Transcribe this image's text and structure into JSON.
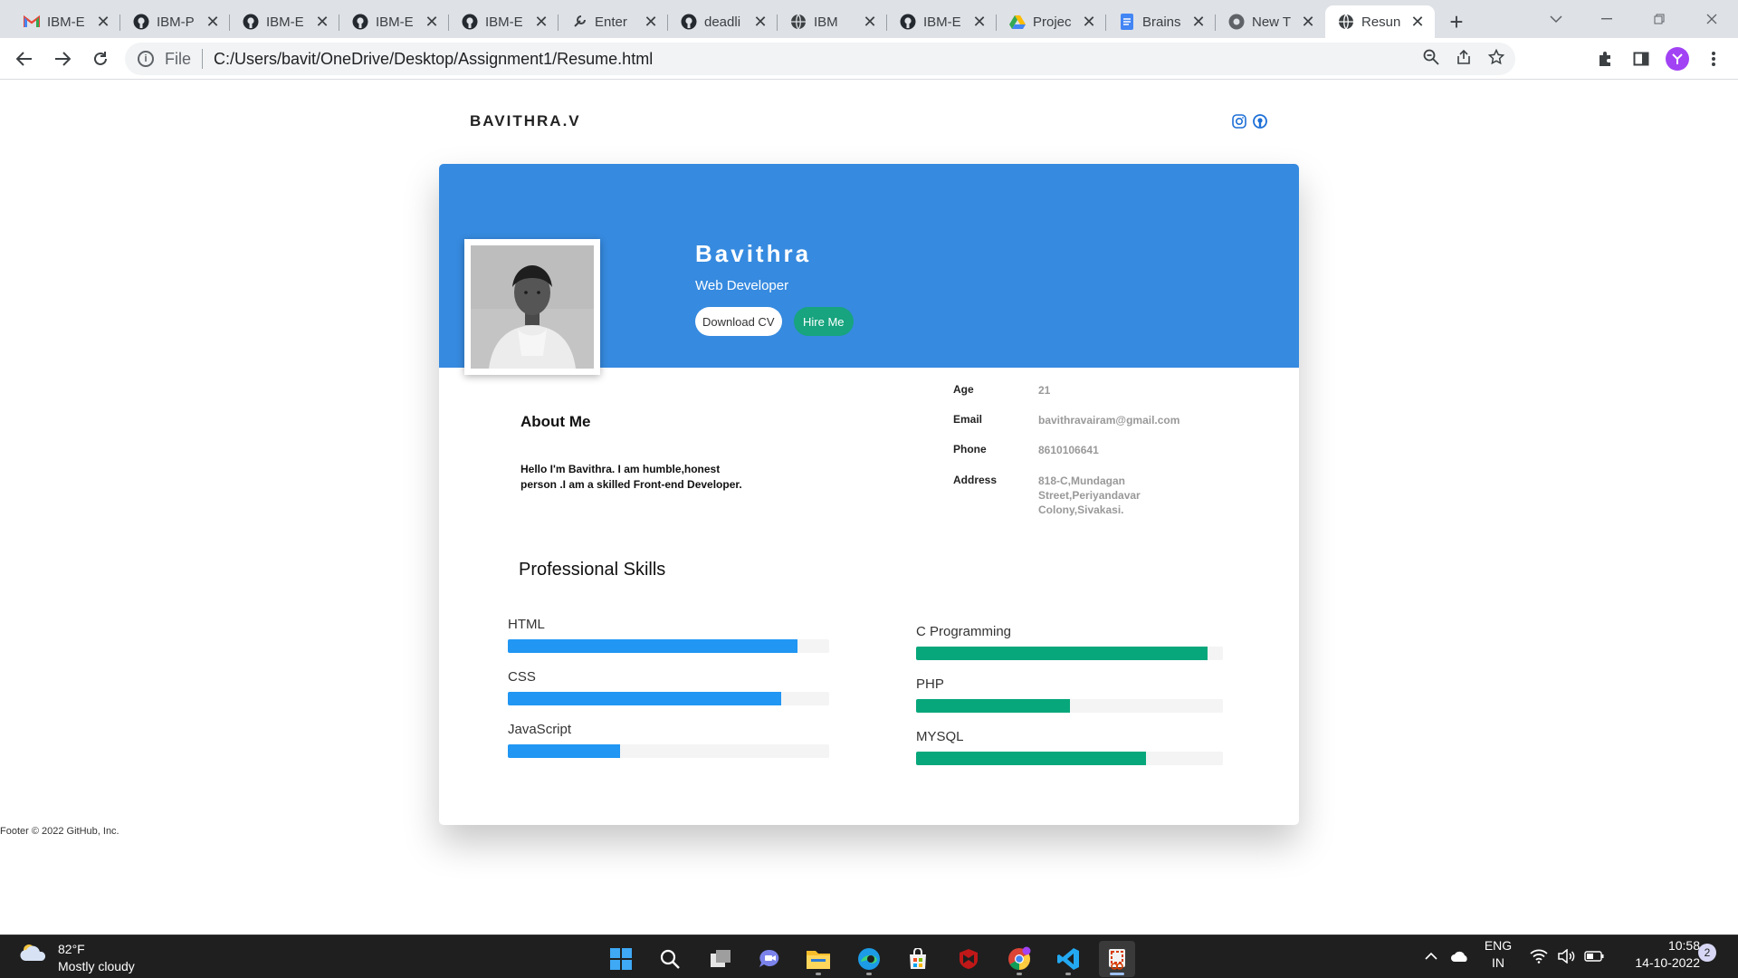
{
  "browser": {
    "tabs": [
      {
        "label": "IBM-E",
        "icon": "gmail-icon"
      },
      {
        "label": "IBM-P",
        "icon": "github-icon"
      },
      {
        "label": "IBM-E",
        "icon": "github-icon"
      },
      {
        "label": "IBM-E",
        "icon": "github-icon"
      },
      {
        "label": "IBM-E",
        "icon": "github-icon"
      },
      {
        "label": "Enter",
        "icon": "wrench-icon"
      },
      {
        "label": "deadli",
        "icon": "github-icon"
      },
      {
        "label": "IBM",
        "icon": "globe-icon"
      },
      {
        "label": "IBM-E",
        "icon": "github-icon"
      },
      {
        "label": "Projec",
        "icon": "google-drive-icon"
      },
      {
        "label": "Brains",
        "icon": "google-docs-icon"
      },
      {
        "label": "New T",
        "icon": "chrome-icon"
      },
      {
        "label": "Resun",
        "icon": "globe-icon"
      }
    ],
    "active_tab_index": 12,
    "address": {
      "scheme": "File",
      "url": "C:/Users/bavit/OneDrive/Desktop/Assignment1/Resume.html"
    }
  },
  "page": {
    "brand": "BAVITHRA.V",
    "profile": {
      "name": "Bavithra",
      "role": "Web Developer",
      "download_label": "Download CV",
      "hire_label": "Hire Me"
    },
    "about": {
      "title": "About Me",
      "text": "Hello I'm Bavithra. I am humble,honest person .I am a skilled Front-end Developer."
    },
    "info": [
      {
        "key": "Age",
        "value": "21"
      },
      {
        "key": "Email",
        "value": "bavithravairam@gmail.com"
      },
      {
        "key": "Phone",
        "value": "8610106641"
      },
      {
        "key": "Address",
        "value": "818-C,Mundagan Street,Periyandavar Colony,Sivakasi."
      }
    ],
    "skills_title": "Professional Skills",
    "skills_left": [
      {
        "name": "HTML",
        "level": 0.9
      },
      {
        "name": "CSS",
        "level": 0.85
      },
      {
        "name": "JavaScript",
        "level": 0.35
      }
    ],
    "skills_right": [
      {
        "name": "C Programming",
        "level": 0.95
      },
      {
        "name": "PHP",
        "level": 0.5
      },
      {
        "name": "MYSQL",
        "level": 0.75
      }
    ],
    "footer": "Footer © 2022 GitHub, Inc."
  },
  "taskbar": {
    "weather": {
      "temp": "82°F",
      "condition": "Mostly cloudy"
    },
    "language": {
      "line1": "ENG",
      "line2": "IN"
    },
    "clock": {
      "time": "10:58",
      "date": "14-10-2022"
    },
    "notifications": "2"
  },
  "colors": {
    "banner": "#368adf",
    "hire_button": "#17a47e",
    "skill_blue": "#2196f3",
    "skill_green": "#07a77b"
  }
}
